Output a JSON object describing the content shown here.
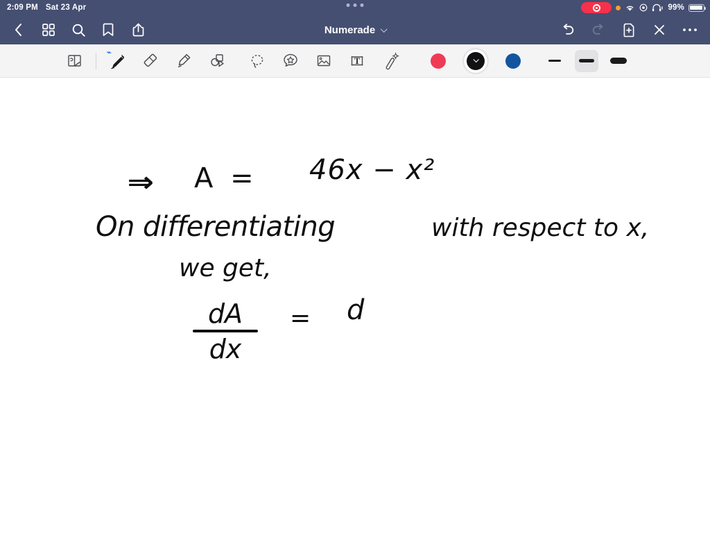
{
  "status_bar": {
    "time": "2:09 PM",
    "date": "Sat 23 Apr",
    "battery_percent": "99%",
    "icons": {
      "record_pill": "screen-record-pill",
      "orange_dot": "microphone-in-use-dot",
      "wifi": "wifi-icon",
      "screen_record": "screen-record-icon",
      "headphones": "headphones-icon",
      "battery": "battery-icon"
    },
    "multitask_handle": "window-handle-dots",
    "colors": {
      "background": "#454f72",
      "text": "#ffffff",
      "record": "#f8314a",
      "orange": "#f0a22e"
    }
  },
  "nav_bar": {
    "title": "Numerade",
    "title_chevron": "chevron-down-icon",
    "left_buttons": [
      {
        "name": "back-button",
        "icon": "chevron-left-icon"
      },
      {
        "name": "thumbnails-button",
        "icon": "grid-icon"
      },
      {
        "name": "search-button",
        "icon": "search-icon"
      },
      {
        "name": "bookmark-button",
        "icon": "bookmark-icon"
      },
      {
        "name": "share-button",
        "icon": "share-icon"
      }
    ],
    "right_buttons": [
      {
        "name": "undo-button",
        "icon": "undo-icon",
        "enabled": true
      },
      {
        "name": "redo-button",
        "icon": "redo-icon",
        "enabled": false
      },
      {
        "name": "add-page-button",
        "icon": "document-plus-icon",
        "enabled": true
      },
      {
        "name": "close-button",
        "icon": "close-x-icon",
        "enabled": true
      },
      {
        "name": "more-button",
        "icon": "ellipsis-icon",
        "enabled": true
      }
    ]
  },
  "toolbar": {
    "tools": [
      {
        "name": "page-flip-tool",
        "icon": "page-flip-icon",
        "selected": false
      },
      {
        "name": "pen-tool",
        "icon": "pen-icon",
        "selected": true,
        "badge": "bluetooth-icon"
      },
      {
        "name": "eraser-tool",
        "icon": "eraser-icon",
        "selected": false
      },
      {
        "name": "highlighter-tool",
        "icon": "highlighter-icon",
        "selected": false
      },
      {
        "name": "shapes-tool",
        "icon": "shapes-icon",
        "selected": false
      },
      {
        "name": "lasso-tool",
        "icon": "lasso-select-icon",
        "selected": false
      },
      {
        "name": "sticker-tool",
        "icon": "sticker-star-icon",
        "selected": false
      },
      {
        "name": "image-tool",
        "icon": "image-icon",
        "selected": false
      },
      {
        "name": "text-tool",
        "icon": "text-box-icon",
        "selected": false
      },
      {
        "name": "magic-wand-tool",
        "icon": "magic-wand-icon",
        "selected": false
      }
    ],
    "colors": [
      {
        "name": "color-red",
        "hex": "#ef3b55",
        "selected": false
      },
      {
        "name": "color-black",
        "hex": "#111113",
        "selected": true
      },
      {
        "name": "color-blue",
        "hex": "#14559f",
        "selected": false
      }
    ],
    "widths": [
      {
        "name": "width-thin",
        "selected": false
      },
      {
        "name": "width-medium",
        "selected": true
      },
      {
        "name": "width-thick",
        "selected": false
      }
    ],
    "colors_meta": {
      "background": "#f4f4f5",
      "selected_bg": "#e2e2e4"
    }
  },
  "canvas": {
    "ink_color": "#0f0f10",
    "lines": [
      {
        "name": "implies-arrow",
        "text": "⇒"
      },
      {
        "name": "area-equation",
        "text": "A  ="
      },
      {
        "name": "area-expression",
        "text": "46x − x²"
      },
      {
        "name": "on-differentiating",
        "text": "On   differentiating"
      },
      {
        "name": "with-respect-to-x",
        "text": "with   respect to x,"
      },
      {
        "name": "we-get",
        "text": "we   get,"
      },
      {
        "name": "derivative-numerator",
        "text": "dA"
      },
      {
        "name": "derivative-denominator",
        "text": "dx"
      },
      {
        "name": "equals-sign",
        "text": "="
      },
      {
        "name": "right-side-d",
        "text": "d"
      }
    ],
    "full_text": "⇒ A = 46x − x² ; On differentiating with respect to x, we get, dA/dx = d"
  }
}
